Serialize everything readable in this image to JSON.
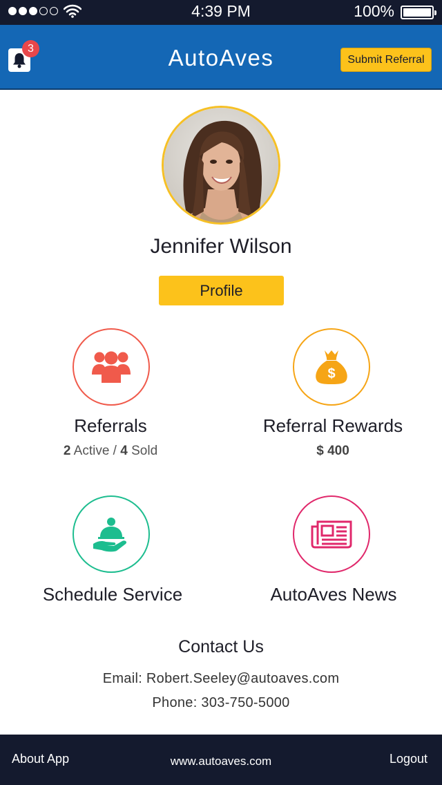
{
  "status_bar": {
    "time": "4:39 PM",
    "battery": "100%",
    "signal_dots": 5,
    "signal_filled": 3
  },
  "app_bar": {
    "title": "AutoAves",
    "notification_count": "3",
    "submit_label": "Submit Referral",
    "icon": "bell-icon"
  },
  "profile": {
    "name": "Jennifer Wilson",
    "button_label": "Profile"
  },
  "tiles": {
    "referrals": {
      "label": "Referrals",
      "active_count": "2",
      "active_text": " Active / ",
      "sold_count": "4",
      "sold_text": " Sold",
      "icon": "group-icon",
      "color": "#f05a4b"
    },
    "rewards": {
      "label": "Referral Rewards",
      "amount": "$ 400",
      "icon": "money-bag-icon",
      "color": "#f6a516"
    },
    "service": {
      "label": "Schedule Service",
      "icon": "service-hand-icon",
      "color": "#1dbd8f"
    },
    "news": {
      "label": "AutoAves News",
      "icon": "newspaper-icon",
      "color": "#e0286b"
    }
  },
  "contact": {
    "title": "Contact Us",
    "email": "Email: Robert.Seeley@autoaves.com",
    "phone": "Phone: 303-750-5000"
  },
  "footer": {
    "about": "About App",
    "website": "www.autoaves.com",
    "logout": "Logout"
  },
  "colors": {
    "status_bar": "#141a2e",
    "app_bar": "#1467b5",
    "accent_yellow": "#fcc21b"
  }
}
